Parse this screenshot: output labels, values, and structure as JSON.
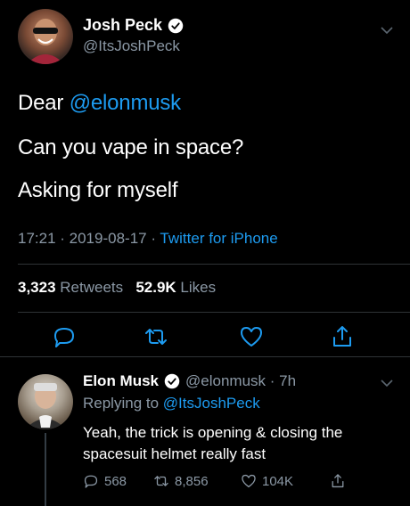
{
  "main_tweet": {
    "author_name": "Josh Peck",
    "author_handle": "@ItsJoshPeck",
    "text_line1_prefix": "Dear ",
    "text_line1_mention": "@elonmusk",
    "text_line2": "Can you vape in space?",
    "text_line3": "Asking for myself",
    "timestamp": "17:21 · 2019-08-17 · ",
    "source": "Twitter for iPhone",
    "retweets_count": "3,323",
    "retweets_label": " Retweets",
    "likes_count": "52.9K",
    "likes_label": " Likes"
  },
  "reply_tweet": {
    "author_name": "Elon Musk",
    "author_handle": "@elonmusk · 7h",
    "replying_prefix": "Replying to ",
    "replying_mention": "@ItsJoshPeck",
    "text": "Yeah, the trick is opening & closing the spacesuit helmet really fast",
    "reply_count": "568",
    "retweet_count": "8,856",
    "like_count": "104K"
  },
  "colors": {
    "background": "#000000",
    "text": "#ffffff",
    "muted": "#8b98a5",
    "accent": "#1d9bf0",
    "divider": "#2f3336"
  },
  "icons": [
    "verified-badge-icon",
    "chevron-down-icon",
    "reply-icon",
    "retweet-icon",
    "like-icon",
    "share-icon"
  ]
}
